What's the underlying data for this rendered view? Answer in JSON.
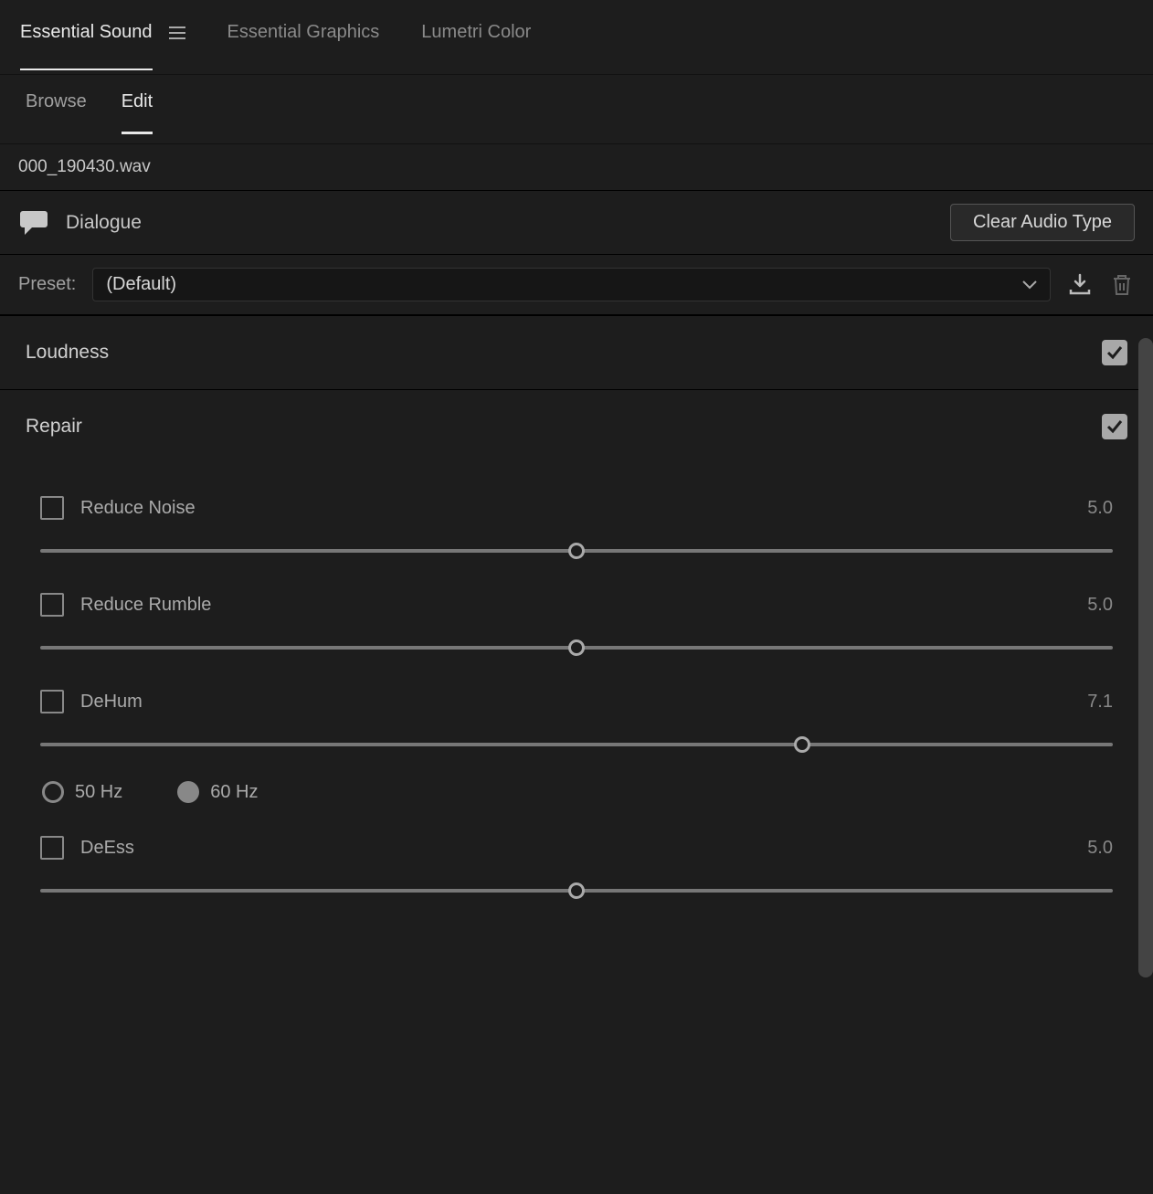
{
  "top_tabs": {
    "essential_sound": "Essential Sound",
    "essential_graphics": "Essential Graphics",
    "lumetri_color": "Lumetri Color"
  },
  "sub_tabs": {
    "browse": "Browse",
    "edit": "Edit"
  },
  "filename": "000_190430.wav",
  "audio_type": {
    "label": "Dialogue",
    "clear_button": "Clear Audio Type"
  },
  "preset": {
    "label": "Preset:",
    "value": "(Default)"
  },
  "sections": {
    "loudness": {
      "title": "Loudness",
      "checked": true
    },
    "repair": {
      "title": "Repair",
      "checked": true
    }
  },
  "repair_params": {
    "reduce_noise": {
      "label": "Reduce Noise",
      "value": "5.0",
      "pos": 50
    },
    "reduce_rumble": {
      "label": "Reduce Rumble",
      "value": "5.0",
      "pos": 50
    },
    "dehum": {
      "label": "DeHum",
      "value": "7.1",
      "pos": 71
    },
    "deess": {
      "label": "DeEss",
      "value": "5.0",
      "pos": 50
    }
  },
  "dehum_freq": {
    "opt1": "50 Hz",
    "opt2": "60 Hz",
    "selected": "60"
  }
}
